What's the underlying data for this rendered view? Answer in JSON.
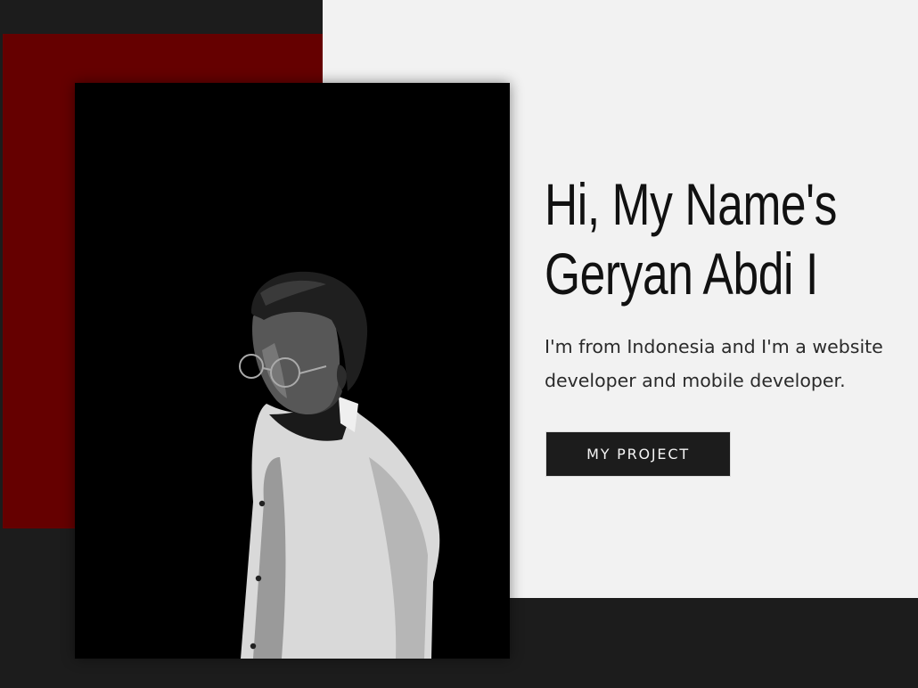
{
  "hero": {
    "title_line1": "Hi, My Name's",
    "title_line2": "Geryan Abdi I",
    "description": "I'm from Indonesia and I'm a website developer and mobile developer.",
    "cta_label": "MY PROJECT"
  },
  "colors": {
    "dark_background": "#1c1c1c",
    "light_panel": "#f2f2f2",
    "accent_red": "#650000",
    "photo_background": "#000000",
    "button_background": "#1c1c1c",
    "button_text": "#f4f4f4"
  },
  "photo": {
    "subject": "portrait-photo"
  }
}
